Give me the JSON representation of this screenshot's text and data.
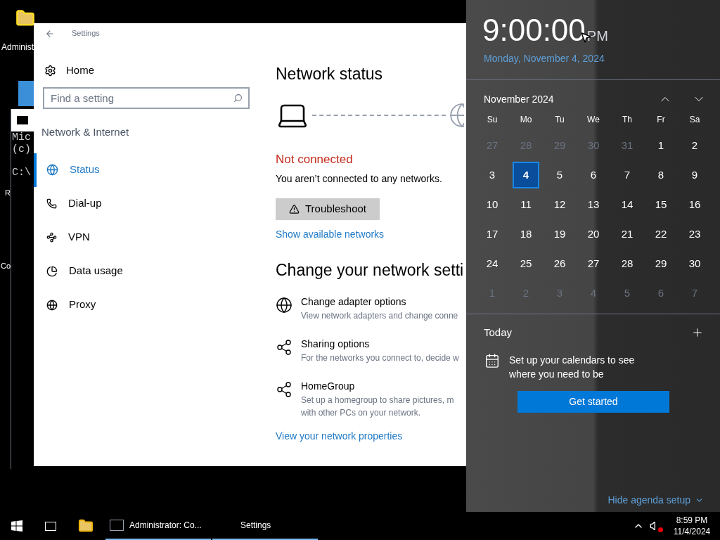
{
  "desktop": {
    "icons": [
      {
        "label": "Administ"
      },
      {
        "label": "R"
      },
      {
        "label": "Co"
      }
    ]
  },
  "console": {
    "lines": [
      "Mic",
      "(c)",
      "C:\\"
    ]
  },
  "settings": {
    "title": "Settings",
    "home": "Home",
    "search": {
      "placeholder": "Find a setting"
    },
    "section": "Network & Internet",
    "nav": [
      {
        "label": "Status",
        "kind": "status",
        "selected": true
      },
      {
        "label": "Dial-up",
        "kind": "dialup",
        "selected": false
      },
      {
        "label": "VPN",
        "kind": "vpn",
        "selected": false
      },
      {
        "label": "Data usage",
        "kind": "data",
        "selected": false
      },
      {
        "label": "Proxy",
        "kind": "proxy",
        "selected": false
      }
    ],
    "heading": "Network status",
    "status": "Not connected",
    "message": "You aren’t connected to any networks.",
    "troubleshoot": "Troubleshoot",
    "show_networks": "Show available networks",
    "heading2": "Change your network setti",
    "options": [
      {
        "kind": "adapter",
        "title": "Change adapter options",
        "description": "View network adapters and change conne"
      },
      {
        "kind": "sharing",
        "title": "Sharing options",
        "description": "For the networks you connect to, decide w"
      },
      {
        "kind": "homegroup",
        "title": "HomeGroup",
        "description": "Set up a homegroup to share pictures, m with other PCs on your network."
      }
    ],
    "properties_link": "View your network properties"
  },
  "flyout": {
    "time": "9:00:00",
    "ampm": "PM",
    "date": "Monday, November 4, 2024",
    "month": "November 2024",
    "weekdays": [
      "Su",
      "Mo",
      "Tu",
      "We",
      "Th",
      "Fr",
      "Sa"
    ],
    "days": [
      {
        "label": "27",
        "current": false,
        "selected": false
      },
      {
        "label": "28",
        "current": false,
        "selected": false
      },
      {
        "label": "29",
        "current": false,
        "selected": false
      },
      {
        "label": "30",
        "current": false,
        "selected": false
      },
      {
        "label": "31",
        "current": false,
        "selected": false
      },
      {
        "label": "1",
        "current": true,
        "selected": false
      },
      {
        "label": "2",
        "current": true,
        "selected": false
      },
      {
        "label": "3",
        "current": true,
        "selected": false
      },
      {
        "label": "4",
        "current": true,
        "selected": true
      },
      {
        "label": "5",
        "current": true,
        "selected": false
      },
      {
        "label": "6",
        "current": true,
        "selected": false
      },
      {
        "label": "7",
        "current": true,
        "selected": false
      },
      {
        "label": "8",
        "current": true,
        "selected": false
      },
      {
        "label": "9",
        "current": true,
        "selected": false
      },
      {
        "label": "10",
        "current": true,
        "selected": false
      },
      {
        "label": "11",
        "current": true,
        "selected": false
      },
      {
        "label": "12",
        "current": true,
        "selected": false
      },
      {
        "label": "13",
        "current": true,
        "selected": false
      },
      {
        "label": "14",
        "current": true,
        "selected": false
      },
      {
        "label": "15",
        "current": true,
        "selected": false
      },
      {
        "label": "16",
        "current": true,
        "selected": false
      },
      {
        "label": "17",
        "current": true,
        "selected": false
      },
      {
        "label": "18",
        "current": true,
        "selected": false
      },
      {
        "label": "19",
        "current": true,
        "selected": false
      },
      {
        "label": "20",
        "current": true,
        "selected": false
      },
      {
        "label": "21",
        "current": true,
        "selected": false
      },
      {
        "label": "22",
        "current": true,
        "selected": false
      },
      {
        "label": "23",
        "current": true,
        "selected": false
      },
      {
        "label": "24",
        "current": true,
        "selected": false
      },
      {
        "label": "25",
        "current": true,
        "selected": false
      },
      {
        "label": "26",
        "current": true,
        "selected": false
      },
      {
        "label": "27",
        "current": true,
        "selected": false
      },
      {
        "label": "28",
        "current": true,
        "selected": false
      },
      {
        "label": "29",
        "current": true,
        "selected": false
      },
      {
        "label": "30",
        "current": true,
        "selected": false
      },
      {
        "label": "1",
        "current": false,
        "selected": false
      },
      {
        "label": "2",
        "current": false,
        "selected": false
      },
      {
        "label": "3",
        "current": false,
        "selected": false
      },
      {
        "label": "4",
        "current": false,
        "selected": false
      },
      {
        "label": "5",
        "current": false,
        "selected": false
      },
      {
        "label": "6",
        "current": false,
        "selected": false
      },
      {
        "label": "7",
        "current": false,
        "selected": false
      }
    ],
    "agenda": {
      "title": "Today",
      "message": "Set up your calendars to see where you need to be",
      "button": "Get started",
      "hide": "Hide agenda setup"
    }
  },
  "taskbar": {
    "apps": [
      {
        "kind": "console",
        "label": "Administrator: Co..."
      },
      {
        "kind": "settings",
        "label": "Settings"
      }
    ],
    "time": "8:59 PM",
    "date": "11/4/2024"
  }
}
